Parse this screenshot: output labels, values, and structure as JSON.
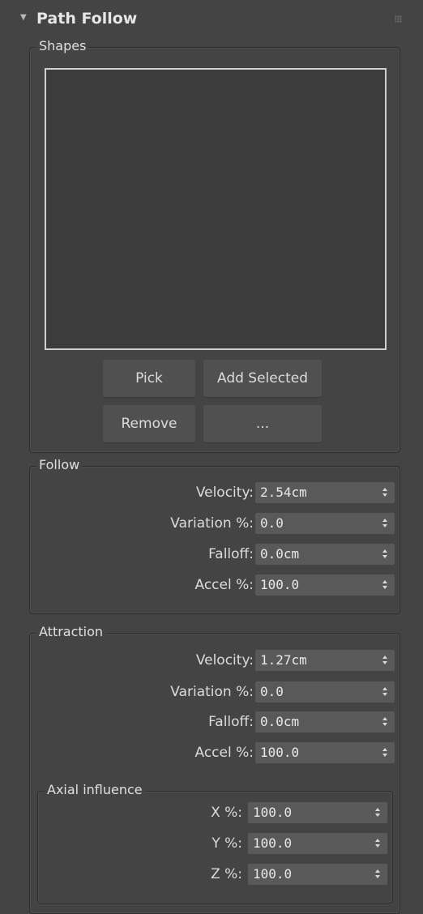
{
  "rollout": {
    "title": "Path Follow"
  },
  "shapes": {
    "group_label": "Shapes",
    "buttons": {
      "pick": "Pick",
      "add_selected": "Add Selected",
      "remove": "Remove",
      "more": "..."
    }
  },
  "follow": {
    "group_label": "Follow",
    "velocity": {
      "label": "Velocity:",
      "value": "2.54cm"
    },
    "variation": {
      "label": "Variation %:",
      "value": "0.0"
    },
    "falloff": {
      "label": "Falloff:",
      "value": "0.0cm"
    },
    "accel": {
      "label": "Accel %:",
      "value": "100.0"
    }
  },
  "attraction": {
    "group_label": "Attraction",
    "velocity": {
      "label": "Velocity:",
      "value": "1.27cm"
    },
    "variation": {
      "label": "Variation %:",
      "value": "0.0"
    },
    "falloff": {
      "label": "Falloff:",
      "value": "0.0cm"
    },
    "accel": {
      "label": "Accel %:",
      "value": "100.0"
    },
    "axial": {
      "group_label": "Axial influence",
      "x": {
        "label": "X %:",
        "value": "100.0"
      },
      "y": {
        "label": "Y %:",
        "value": "100.0"
      },
      "z": {
        "label": "Z %:",
        "value": "100.0"
      }
    }
  }
}
